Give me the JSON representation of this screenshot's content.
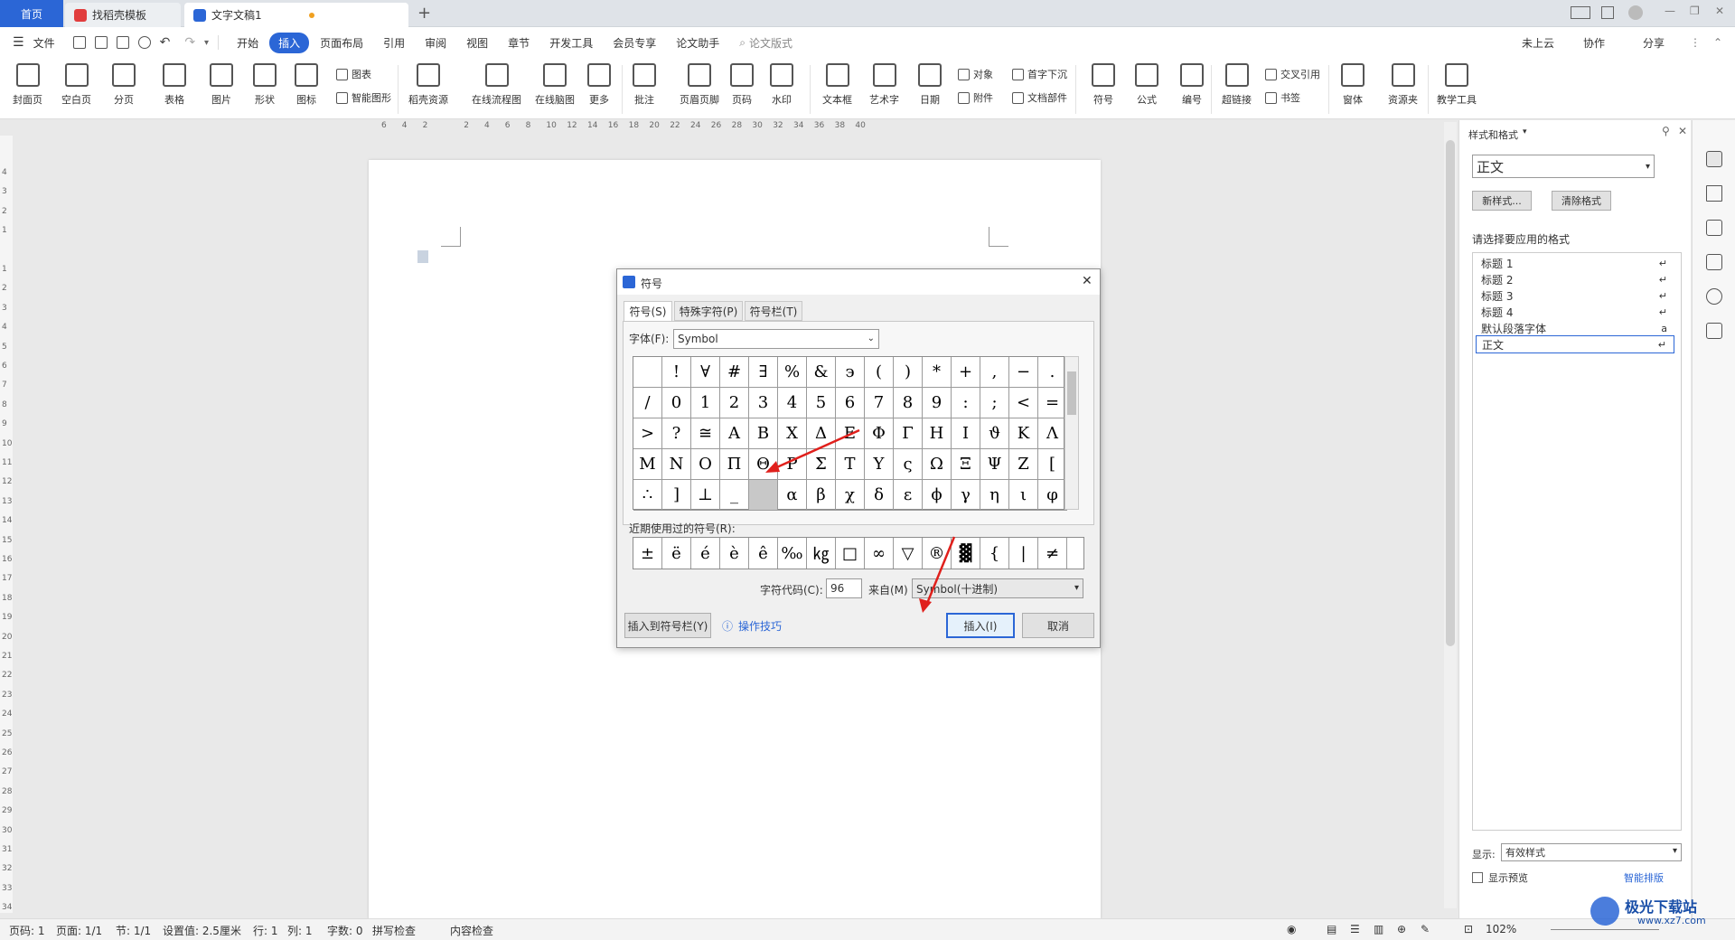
{
  "tabs": {
    "home": "首页",
    "template": "找稻壳模板",
    "doc": "文字文稿1",
    "add": "+"
  },
  "titlebar_right": {
    "minimize": "—",
    "restore": "❐",
    "close": "✕"
  },
  "menubar": {
    "file": "文件",
    "items": [
      "开始",
      "插入",
      "页面布局",
      "引用",
      "审阅",
      "视图",
      "章节",
      "开发工具",
      "会员专享",
      "论文助手"
    ],
    "active_index": 1,
    "search": "论文版式",
    "cloud": "未上云",
    "collab": "协作",
    "share": "分享"
  },
  "ribbon": {
    "big": [
      "封面页",
      "空白页",
      "分页",
      "表格",
      "图片",
      "形状",
      "图标",
      "稻壳资源",
      "在线流程图",
      "在线脑图",
      "更多",
      "批注",
      "页眉页脚",
      "页码",
      "水印",
      "文本框",
      "艺术字",
      "日期",
      "符号",
      "公式",
      "编号",
      "超链接",
      "窗体",
      "资源夹",
      "教学工具"
    ],
    "small": [
      "图表",
      "智能图形",
      "对象",
      "附件",
      "首字下沉",
      "文档部件",
      "交叉引用",
      "书签"
    ]
  },
  "ruler": {
    "ticks": [
      "6",
      "4",
      "2",
      "",
      "2",
      "4",
      "6",
      "8",
      "10",
      "12",
      "14",
      "16",
      "18",
      "20",
      "22",
      "24",
      "26",
      "28",
      "30",
      "32",
      "34",
      "36",
      "38",
      "40"
    ]
  },
  "vruler": {
    "ticks": [
      "4",
      "3",
      "2",
      "1",
      "",
      "1",
      "2",
      "3",
      "4",
      "5",
      "6",
      "7",
      "8",
      "9",
      "10",
      "11",
      "12",
      "13",
      "14",
      "15",
      "16",
      "17",
      "18",
      "19",
      "20",
      "21",
      "22",
      "23",
      "24",
      "25",
      "26",
      "27",
      "28",
      "29",
      "30",
      "31",
      "32",
      "33",
      "34"
    ]
  },
  "dialog": {
    "title": "符号",
    "tabs": [
      "符号(S)",
      "特殊字符(P)",
      "符号栏(T)"
    ],
    "font_label": "字体(F):",
    "font_value": "Symbol",
    "grid": [
      [
        "",
        " !",
        "∀",
        "#",
        "∃",
        "%",
        "&",
        "϶",
        "(",
        ")",
        "*",
        "+",
        ",",
        "−",
        "."
      ],
      [
        "/",
        "0",
        "1",
        "2",
        "3",
        "4",
        "5",
        "6",
        "7",
        "8",
        "9",
        ":",
        ";",
        "<",
        "="
      ],
      [
        ">",
        "?",
        "≅",
        "Α",
        "Β",
        "Χ",
        "Δ",
        "Ε",
        "Φ",
        "Γ",
        "Η",
        "Ι",
        "ϑ",
        "Κ",
        "Λ"
      ],
      [
        "Μ",
        "Ν",
        "Ο",
        "Π",
        "Θ",
        "Ρ",
        "Σ",
        "Τ",
        "Υ",
        "ς",
        "Ω",
        "Ξ",
        "Ψ",
        "Ζ",
        "["
      ],
      [
        "∴",
        "]",
        "⊥",
        "_",
        "",
        "α",
        "β",
        "χ",
        "δ",
        "ε",
        "ϕ",
        "γ",
        "η",
        "ι",
        "φ"
      ]
    ],
    "recent_label": "近期使用过的符号(R):",
    "recent": [
      "±",
      "ë",
      "é",
      "è",
      "ê",
      "‰",
      "㎏",
      "□",
      "∞",
      "▽",
      "®",
      "▓",
      "{",
      "|",
      "≠"
    ],
    "code_label": "字符代码(C):",
    "code_value": "96",
    "from_label": "来自(M)",
    "from_value": "Symbol(十进制)",
    "insert_bar": "插入到符号栏(Y)",
    "tips": "操作技巧",
    "insert": "插入(I)",
    "cancel": "取消"
  },
  "style_pane": {
    "title": "样式和格式",
    "current": "正文",
    "new_style": "新样式...",
    "clear": "清除格式",
    "choose_label": "请选择要应用的格式",
    "styles": [
      {
        "name": "标题 1",
        "mark": "↵"
      },
      {
        "name": "标题 2",
        "mark": "↵"
      },
      {
        "name": "标题 3",
        "mark": "↵"
      },
      {
        "name": "标题 4",
        "mark": "↵"
      },
      {
        "name": "默认段落字体",
        "mark": "a"
      },
      {
        "name": "正文",
        "mark": "↵"
      }
    ],
    "show_label": "显示:",
    "show_value": "有效样式",
    "preview": "显示预览",
    "smart": "智能排版"
  },
  "status": {
    "page": "页码: 1",
    "pages": "页面: 1/1",
    "section": "节: 1/1",
    "setting": "设置值: 2.5厘米",
    "row": "行: 1",
    "col": "列: 1",
    "words": "字数: 0",
    "spell": "拼写检查",
    "content": "内容检查",
    "zoom": "102%"
  },
  "watermark": {
    "brand": "极光下载站",
    "url": "www.xz7.com"
  }
}
